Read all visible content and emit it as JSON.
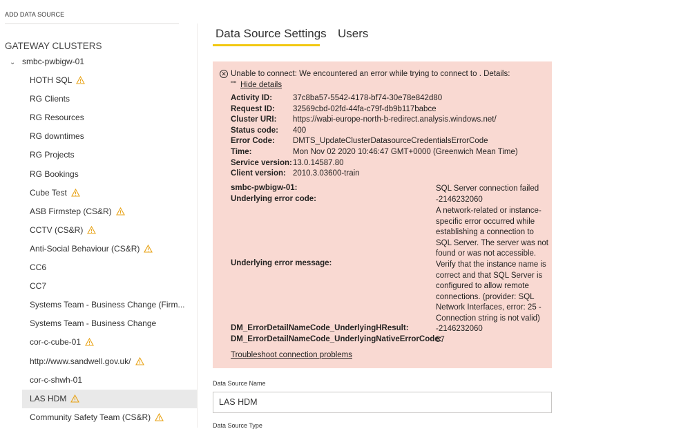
{
  "sidebar": {
    "add_data_source": "ADD DATA SOURCE",
    "section_title": "GATEWAY CLUSTERS",
    "cluster": "smbc-pwbigw-01",
    "items": [
      {
        "label": "HOTH SQL",
        "warning": true
      },
      {
        "label": "RG Clients",
        "warning": false
      },
      {
        "label": "RG Resources",
        "warning": false
      },
      {
        "label": "RG downtimes",
        "warning": false
      },
      {
        "label": "RG Projects",
        "warning": false
      },
      {
        "label": "RG Bookings",
        "warning": false
      },
      {
        "label": "Cube Test",
        "warning": true
      },
      {
        "label": "ASB Firmstep (CS&R)",
        "warning": true
      },
      {
        "label": "CCTV (CS&R)",
        "warning": true
      },
      {
        "label": "Anti-Social Behaviour (CS&R)",
        "warning": true
      },
      {
        "label": "CC6",
        "warning": false
      },
      {
        "label": "CC7",
        "warning": false
      },
      {
        "label": "Systems Team - Business Change (Firm...",
        "warning": false
      },
      {
        "label": "Systems Team - Business Change",
        "warning": false
      },
      {
        "label": "cor-c-cube-01",
        "warning": true
      },
      {
        "label": "http://www.sandwell.gov.uk/",
        "warning": true
      },
      {
        "label": "cor-c-shwh-01",
        "warning": false
      },
      {
        "label": "LAS HDM",
        "warning": true,
        "selected": true
      },
      {
        "label": "Community Safety Team (CS&R)",
        "warning": true
      }
    ]
  },
  "tabs": {
    "settings": "Data Source Settings",
    "users": "Users"
  },
  "colors": {
    "accent": "#f2c811",
    "error_bg": "#f9d9d2",
    "warning": "#e8a317"
  },
  "error": {
    "message": "Unable to connect: We encountered an error while trying to connect to . Details:",
    "quote": "\"\"",
    "hide_details": "Hide details",
    "details": [
      {
        "label": "Activity ID:",
        "value": "37c8ba57-5542-4178-bf74-30e78e842d80"
      },
      {
        "label": "Request ID:",
        "value": "32569cbd-02fd-44fa-c79f-db9b117babce"
      },
      {
        "label": "Cluster URI:",
        "value": "https://wabi-europe-north-b-redirect.analysis.windows.net/"
      },
      {
        "label": "Status code:",
        "value": "400"
      },
      {
        "label": "Error Code:",
        "value": "DMTS_UpdateClusterDatasourceCredentialsErrorCode"
      },
      {
        "label": "Time:",
        "value": "Mon Nov 02 2020 10:46:47 GMT+0000 (Greenwich Mean Time)"
      },
      {
        "label": "Service version:",
        "value": "13.0.14587.80"
      },
      {
        "label": "Client version:",
        "value": "2010.3.03600-train"
      }
    ],
    "underlying": [
      {
        "label": "smbc-pwbigw-01:",
        "value": "SQL Server connection failed"
      },
      {
        "label": "Underlying error code:",
        "value": "-2146232060"
      },
      {
        "label": "Underlying error message:",
        "value": "A network-related or instance-specific error occurred while establishing a connection to SQL Server. The server was not found or was not accessible. Verify that the instance name is correct and that SQL Server is configured to allow remote connections. (provider: SQL Network Interfaces, error: 25 - Connection string is not valid)"
      },
      {
        "label": "DM_ErrorDetailNameCode_UnderlyingHResult:",
        "value": "-2146232060"
      },
      {
        "label": "DM_ErrorDetailNameCode_UnderlyingNativeErrorCode:",
        "value": "87"
      }
    ],
    "troubleshoot": "Troubleshoot connection problems"
  },
  "form": {
    "name_label": "Data Source Name",
    "name_value": "LAS HDM",
    "type_label": "Data Source Type"
  }
}
